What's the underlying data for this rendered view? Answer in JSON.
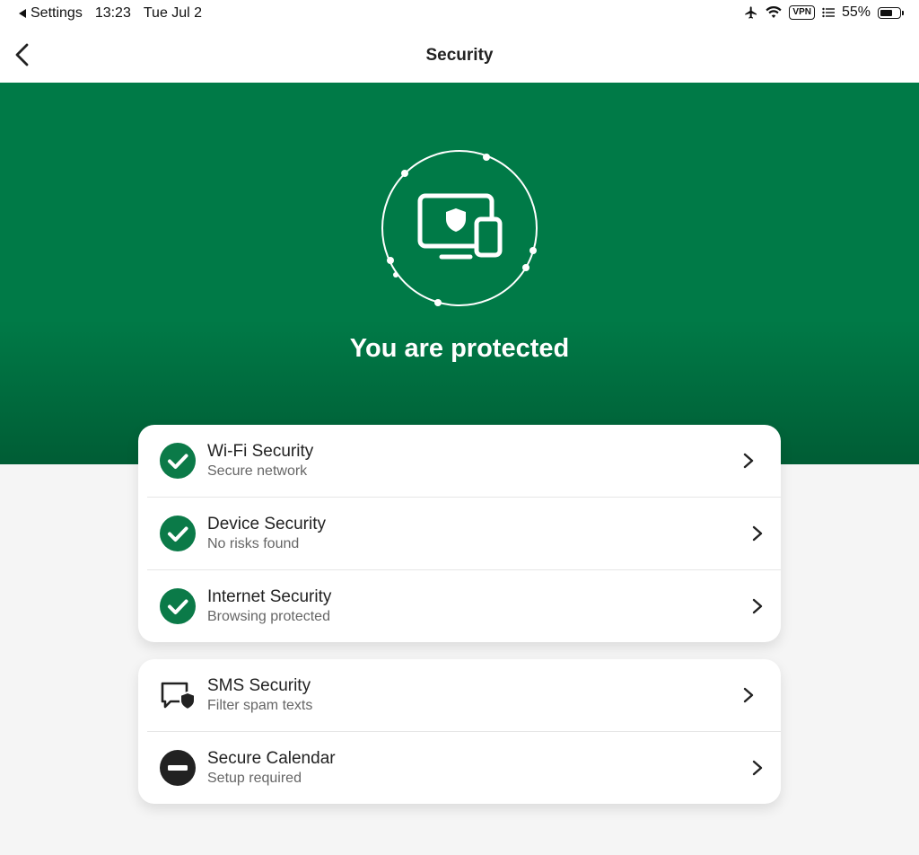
{
  "status_bar": {
    "back_app": "Settings",
    "time": "13:23",
    "date": "Tue Jul 2",
    "vpn": "VPN",
    "battery": "55%"
  },
  "nav": {
    "title": "Security"
  },
  "hero": {
    "title": "You are protected"
  },
  "protection_items": [
    {
      "title": "Wi-Fi Security",
      "subtitle": "Secure network",
      "status": "check-icon"
    },
    {
      "title": "Device Security",
      "subtitle": "No risks found",
      "status": "check-icon"
    },
    {
      "title": "Internet Security",
      "subtitle": "Browsing protected",
      "status": "check-icon"
    }
  ],
  "extra_items": [
    {
      "title": "SMS Security",
      "subtitle": "Filter spam texts",
      "status": "message-shield-icon"
    },
    {
      "title": "Secure Calendar",
      "subtitle": "Setup required",
      "status": "minus-circle-icon"
    }
  ],
  "colors": {
    "brand_green": "#007a47",
    "brand_green_dark": "#005d35",
    "check_green": "#0b7a48",
    "background": "#f5f5f5"
  }
}
